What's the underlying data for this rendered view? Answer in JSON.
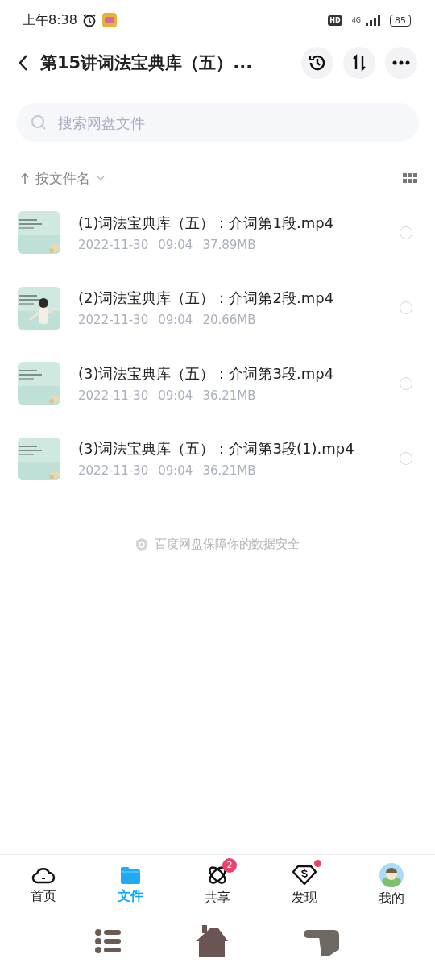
{
  "status_bar": {
    "time": "上午8:38",
    "hd": "HD",
    "network": "4G",
    "battery": "85"
  },
  "header": {
    "title": "第15讲词法宝典库（五）..."
  },
  "search": {
    "placeholder": "搜索网盘文件"
  },
  "sort": {
    "label": "按文件名"
  },
  "files": [
    {
      "name": "(1)词法宝典库（五）：介词第1段.mp4",
      "date": "2022-11-30",
      "time": "09:04",
      "size": "37.89MB",
      "selected": false,
      "kind": "picture"
    },
    {
      "name": "(2)词法宝典库（五）：介词第2段.mp4",
      "date": "2022-11-30",
      "time": "09:04",
      "size": "20.66MB",
      "selected": false,
      "kind": "picture"
    },
    {
      "name": "(3)词法宝典库（五）：介词第3段.mp4",
      "date": "2022-11-30",
      "time": "09:04",
      "size": "36.21MB",
      "selected": false,
      "kind": "picture"
    },
    {
      "name": "(3)词法宝典库（五）：介词第3段(1).mp4",
      "date": "2022-11-30",
      "time": "09:04",
      "size": "36.21MB",
      "selected": false,
      "kind": "picture"
    }
  ],
  "footer_note": "百度网盘保障你的数据安全",
  "tab_bar": [
    {
      "label": "首页",
      "kind": "home",
      "selected": false,
      "notification_dot": false
    },
    {
      "label": "文件",
      "kind": "files",
      "selected": true,
      "notification_dot": false
    },
    {
      "label": "共享",
      "kind": "share",
      "selected": false,
      "badge": "2",
      "notification_dot": false
    },
    {
      "label": "发现",
      "kind": "discover",
      "selected": false,
      "notification_dot": true
    },
    {
      "label": "我的",
      "kind": "me",
      "selected": false,
      "notification_dot": false
    }
  ]
}
